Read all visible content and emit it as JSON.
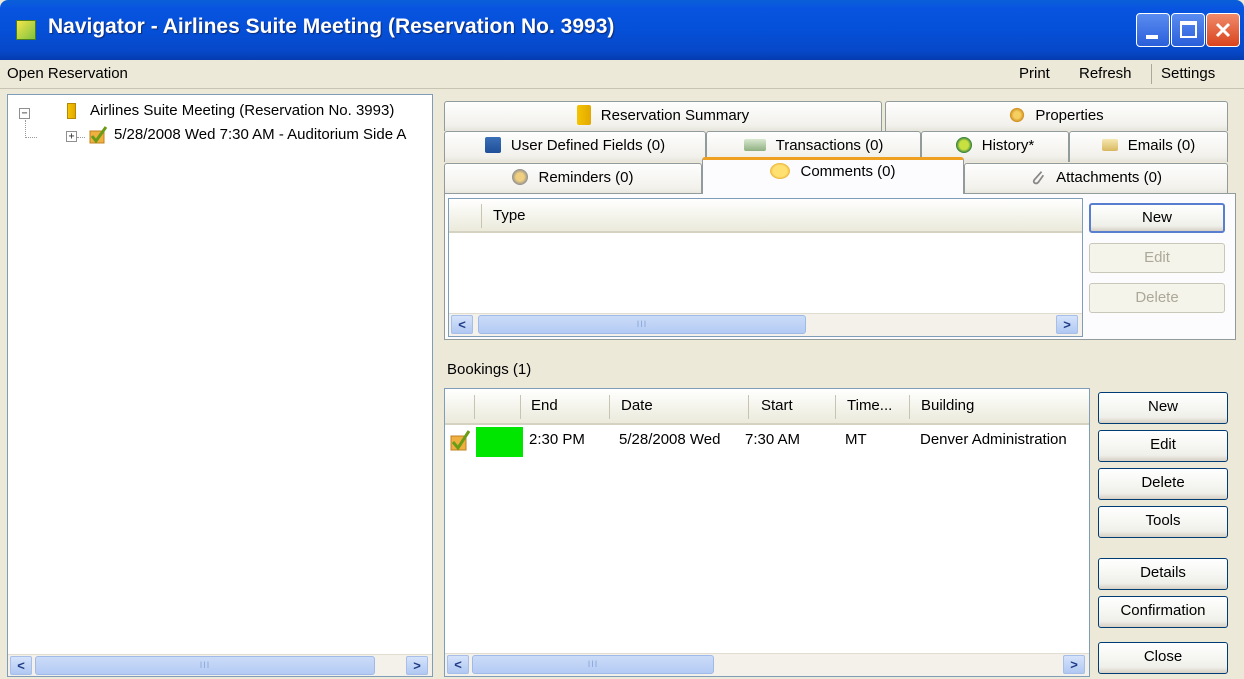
{
  "window": {
    "title": "Navigator - Airlines Suite Meeting (Reservation No. 3993)"
  },
  "menu": {
    "left": [
      "Open Reservation"
    ],
    "right": [
      "Print",
      "Refresh",
      "Settings"
    ]
  },
  "tree": {
    "root_label": "Airlines Suite Meeting (Reservation No. 3993)",
    "root_expander": "−",
    "child_label": "5/28/2008 Wed 7:30 AM - Auditorium Side A",
    "child_expander": "+"
  },
  "tabs": {
    "row1": [
      {
        "label": "Reservation Summary",
        "icon": "folder-icon"
      },
      {
        "label": "Properties",
        "icon": "gear-icon"
      }
    ],
    "row2": [
      {
        "label": "User Defined Fields (0)",
        "icon": "user-icon"
      },
      {
        "label": "Transactions (0)",
        "icon": "money-icon"
      },
      {
        "label": "History*",
        "icon": "history-icon"
      },
      {
        "label": "Emails (0)",
        "icon": "email-icon"
      }
    ],
    "row3": [
      {
        "label": "Reminders (0)",
        "icon": "reminder-icon"
      },
      {
        "label": "Comments (0)",
        "icon": "comment-icon",
        "active": true
      },
      {
        "label": "Attachments (0)",
        "icon": "paperclip-icon"
      }
    ]
  },
  "comments": {
    "columns": [
      "Type"
    ],
    "buttons": {
      "new": "New",
      "edit": "Edit",
      "delete": "Delete"
    }
  },
  "bookings": {
    "label": "Bookings (1)",
    "columns": [
      "End",
      "Date",
      "Start",
      "Time...",
      "Building"
    ],
    "rows": [
      {
        "end": "2:30 PM",
        "date": "5/28/2008 Wed",
        "start": "7:30 AM",
        "timezone": "MT",
        "building": "Denver Administration",
        "status_color": "#00e600"
      }
    ],
    "buttons": {
      "new": "New",
      "edit": "Edit",
      "delete": "Delete",
      "tools": "Tools",
      "details": "Details",
      "confirmation": "Confirmation",
      "close": "Close"
    }
  },
  "scroll_grip": "III",
  "arrows": {
    "left": "<",
    "right": ">"
  }
}
